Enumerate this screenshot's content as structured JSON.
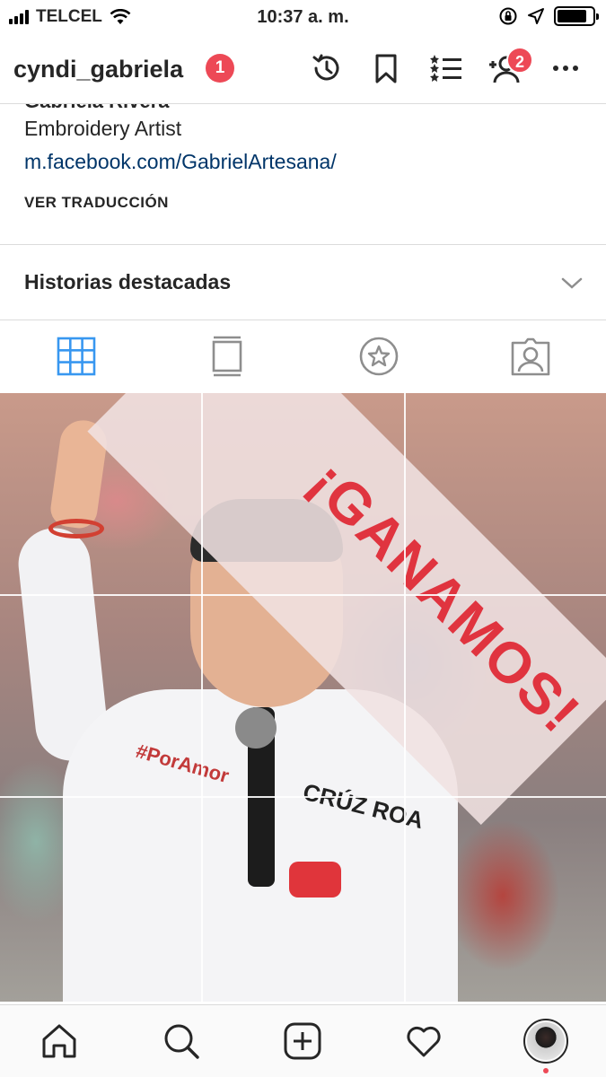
{
  "status_bar": {
    "carrier": "TELCEL",
    "time": "10:37 a. m.",
    "battery_level": 0.85,
    "icons": [
      "signal-icon",
      "wifi-icon",
      "rotation-lock-icon",
      "location-arrow-icon",
      "battery-icon"
    ]
  },
  "header": {
    "username": "cyndi_gabriela",
    "notification_count": "1",
    "follow_requests_count": "2",
    "icons": [
      "archive-history-icon",
      "saved-bookmark-icon",
      "close-friends-list-icon",
      "discover-people-icon",
      "more-options-icon"
    ]
  },
  "bio": {
    "name": "Gabriela Rivera",
    "category": "Embroidery Artist",
    "link": "m.facebook.com/GabrielArtesana/",
    "translate_label": "VER TRADUCCIÓN"
  },
  "highlights": {
    "label": "Historias destacadas"
  },
  "tabs": [
    {
      "name": "grid",
      "active": true
    },
    {
      "name": "feed",
      "active": false
    },
    {
      "name": "saved-star",
      "active": false
    },
    {
      "name": "tagged",
      "active": false
    }
  ],
  "post": {
    "banner_text": "¡GANAMOS!",
    "shirt_label": "CRÚZ ROA",
    "shirt_logo": "#PorAmor"
  },
  "bottom_nav": {
    "icons": [
      "home-icon",
      "search-icon",
      "new-post-icon",
      "activity-heart-icon",
      "profile-avatar"
    ]
  },
  "colors": {
    "accent_blue": "#3897f0",
    "badge_red": "#ed4956",
    "link_blue": "#003569",
    "banner_red": "#e0343f"
  }
}
